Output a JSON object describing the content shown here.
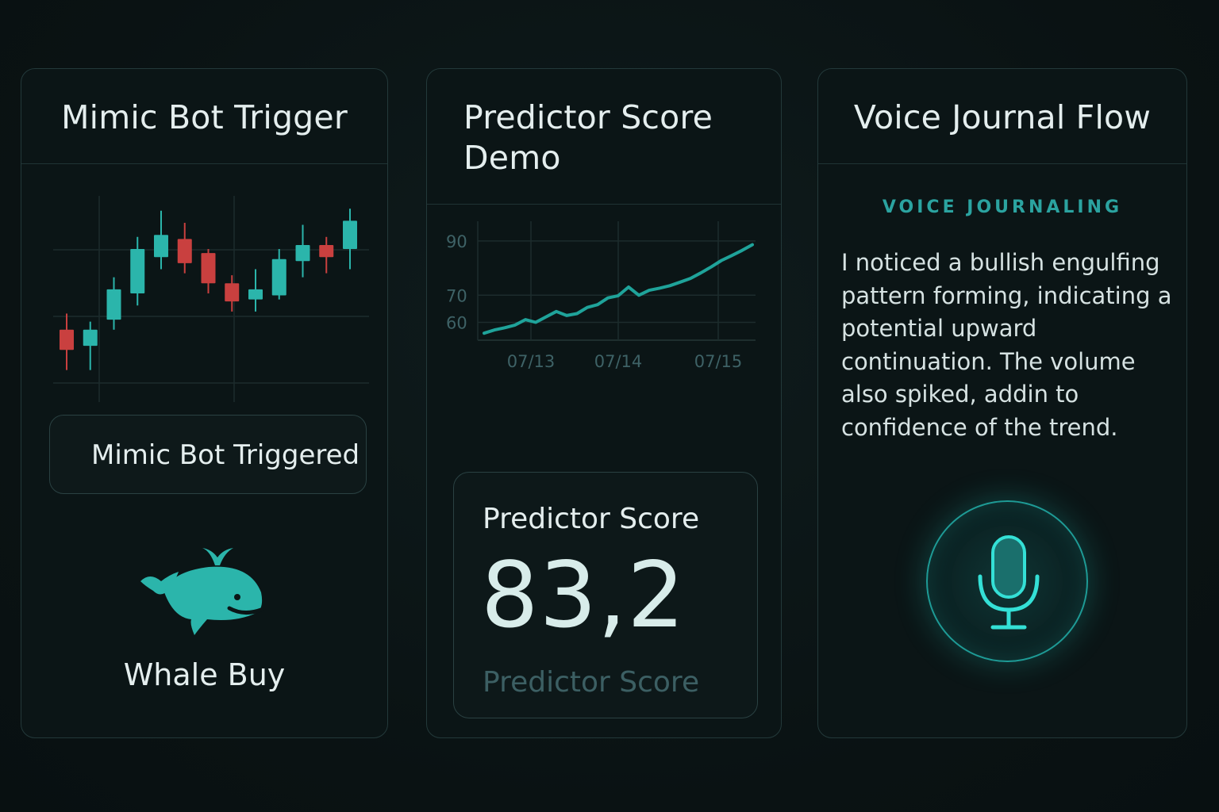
{
  "cards": {
    "mimic": {
      "title": "Mimic Bot Trigger",
      "trigger_text": "Mimic Bot Triggered",
      "whale_label": "Whale Buy"
    },
    "predictor": {
      "title": "Predictor Score Demo",
      "score_label": "Predictor Score",
      "score_value": "83,2",
      "score_sub": "Predictor Score"
    },
    "voice": {
      "title": "Voice Journal Flow",
      "section_label": "VOICE JOURNALING",
      "journal_text": "I noticed a bullish engulfing pattern forming, indicating a potential upward continuation. The volume also spiked, addin to confidence of the trend."
    }
  },
  "icons": {
    "whale": "whale-icon",
    "microphone": "microphone-icon"
  },
  "colors": {
    "background": "#0b1415",
    "card_border": "#23393a",
    "accent_teal": "#2bb5ab",
    "bearish_red": "#c9403f",
    "text_primary": "#e4eeee",
    "text_muted": "#3c5f63"
  },
  "chart_data": [
    {
      "type": "candlestick",
      "title": "",
      "candles": [
        {
          "open": 1.0,
          "close": 2.0,
          "high": 2.8,
          "low": 0.0,
          "dir": "down"
        },
        {
          "open": 1.2,
          "close": 2.0,
          "high": 2.4,
          "low": 0.0,
          "dir": "up"
        },
        {
          "open": 2.5,
          "close": 4.0,
          "high": 4.6,
          "low": 2.0,
          "dir": "up"
        },
        {
          "open": 3.8,
          "close": 6.0,
          "high": 6.6,
          "low": 3.2,
          "dir": "up"
        },
        {
          "open": 5.6,
          "close": 6.7,
          "high": 7.9,
          "low": 5.0,
          "dir": "up"
        },
        {
          "open": 6.5,
          "close": 5.3,
          "high": 7.3,
          "low": 4.8,
          "dir": "down"
        },
        {
          "open": 5.8,
          "close": 4.3,
          "high": 6.0,
          "low": 3.8,
          "dir": "down"
        },
        {
          "open": 4.3,
          "close": 3.4,
          "high": 4.7,
          "low": 2.9,
          "dir": "down"
        },
        {
          "open": 3.5,
          "close": 4.0,
          "high": 5.0,
          "low": 2.9,
          "dir": "up"
        },
        {
          "open": 3.7,
          "close": 5.5,
          "high": 6.0,
          "low": 3.5,
          "dir": "up"
        },
        {
          "open": 5.4,
          "close": 6.2,
          "high": 7.2,
          "low": 4.6,
          "dir": "up"
        },
        {
          "open": 6.2,
          "close": 5.6,
          "high": 6.6,
          "low": 4.8,
          "dir": "down"
        },
        {
          "open": 6.0,
          "close": 7.4,
          "high": 8.0,
          "low": 5.0,
          "dir": "up"
        }
      ]
    },
    {
      "type": "line",
      "title": "",
      "x_ticks": [
        "07/13",
        "07/14",
        "07/15"
      ],
      "y_ticks": [
        60,
        70,
        90
      ],
      "ylim": [
        54,
        92
      ],
      "series": [
        {
          "values": [
            56.0,
            57.2,
            58.0,
            59.0,
            61.0,
            60.0,
            62.0,
            64.0,
            62.5,
            63.2,
            65.5,
            66.5,
            69.0,
            69.8,
            73.0,
            70.0,
            71.8,
            72.6,
            73.5,
            74.8,
            76.2,
            78.2,
            80.4,
            82.8,
            84.6,
            86.5,
            88.6
          ]
        }
      ]
    }
  ]
}
